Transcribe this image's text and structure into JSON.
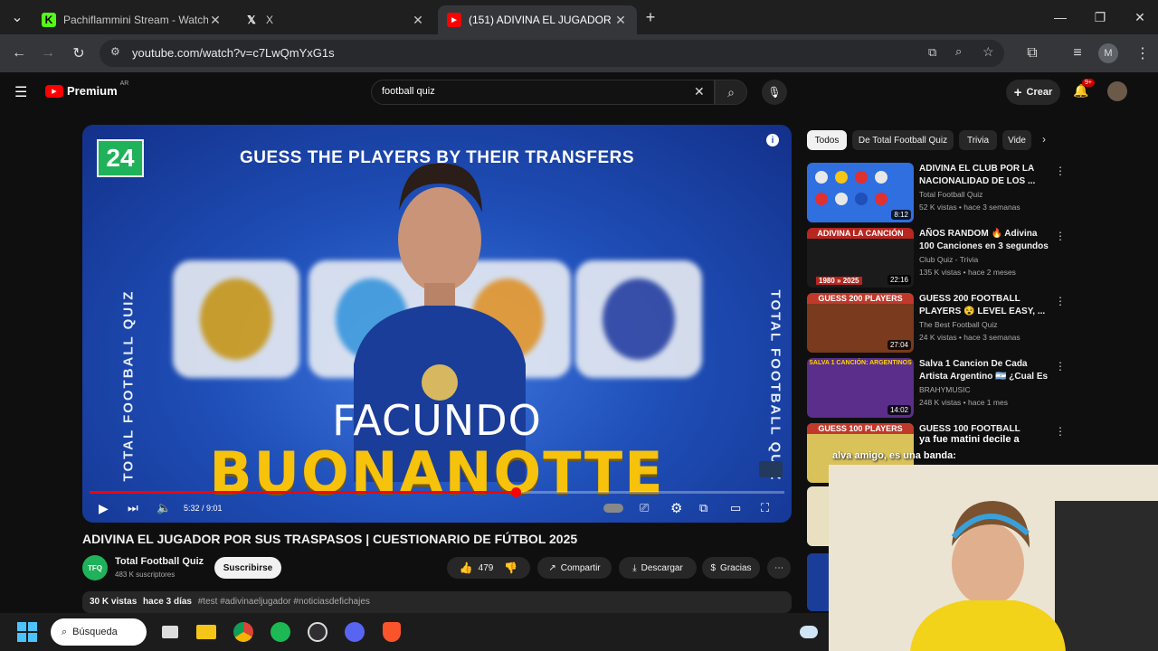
{
  "browser": {
    "tabs": [
      {
        "title": "Pachiflammini Stream - Watch",
        "favicon": "kick-icon"
      },
      {
        "title": "X",
        "favicon": "x-icon"
      },
      {
        "title": "(151) ADIVINA EL JUGADOR PO",
        "favicon": "youtube-icon"
      }
    ],
    "new_tab": "+",
    "url": "youtube.com/watch?v=c7LwQmYxG1s",
    "profile_initial": "M"
  },
  "youtube": {
    "logo_label": "Premium",
    "region": "AR",
    "search_value": "football quiz",
    "create_label": "Crear",
    "notif_count": "9+"
  },
  "video": {
    "badge": "24",
    "overlay_title": "GUESS THE PLAYERS BY THEIR TRANSFERS",
    "side_label": "TOTAL FOOTBALL QUIZ",
    "first_name": "FACUNDO",
    "last_name": "BUONANOTTE",
    "time": "5:32 / 9:01",
    "progress_fraction": 0.613,
    "title": "ADIVINA EL JUGADOR POR SUS TRASPASOS | CUESTIONARIO DE FÚTBOL 2025",
    "channel": "Total Football Quiz",
    "subscribers": "483 K suscriptores",
    "subscribe_label": "Suscribirse",
    "likes": "479",
    "share_label": "Compartir",
    "download_label": "Descargar",
    "thanks_label": "Gracias",
    "views": "30 K vistas",
    "age": "hace 3 días",
    "hashtags": "#test #adivinaeljugador #noticiasdefichajes"
  },
  "sidebar": {
    "chips": [
      "Todos",
      "De Total Football Quiz",
      "Trivia",
      "Vide"
    ],
    "items": [
      {
        "title": "ADIVINA EL CLUB POR LA NACIONALIDAD DE LOS ...",
        "channel": "Total Football Quiz",
        "meta": "52 K vistas • hace 3 semanas",
        "duration": "8:12",
        "thumb_color": "#2f6fe0"
      },
      {
        "title": "AÑOS RANDOM 🔥 Adivina 100 Canciones en 3 segundos 🎵 ...",
        "channel": "Club Quiz - Trivia",
        "meta": "135 K vistas • hace 2 meses",
        "duration": "22:16",
        "thumb_color": "#b7261f",
        "thumb_text": "ADIVINA LA CANCIÓN",
        "thumb_sub": "1980 » 2025"
      },
      {
        "title": "GUESS 200 FOOTBALL PLAYERS 😵 LEVEL EASY, ...",
        "channel": "The Best Football Quiz",
        "meta": "24 K vistas • hace 3 semanas",
        "duration": "27:04",
        "thumb_color": "#c0392b",
        "thumb_text": "GUESS 200 PLAYERS"
      },
      {
        "title": "Salva 1 Cancion De Cada Artista Argentino 🇦🇷 ¿Cual Es T...",
        "channel": "BRAHYMUSIC",
        "meta": "248 K vistas • hace 1 mes",
        "duration": "14:02",
        "thumb_color": "#7a3fb0",
        "thumb_text": "SALVA 1 CANCIÓN: ARGENTINOS"
      },
      {
        "title": "GUESS 100 FOOTBALL",
        "channel": "",
        "meta": "",
        "duration": "",
        "thumb_color": "#c0392b",
        "thumb_text": "GUESS 100 PLAYERS"
      }
    ]
  },
  "chat_overlay": {
    "line1": "ya fue matini decile a",
    "line2": "alva amigo, es una banda:"
  },
  "taskbar": {
    "search_label": "Búsqueda"
  }
}
